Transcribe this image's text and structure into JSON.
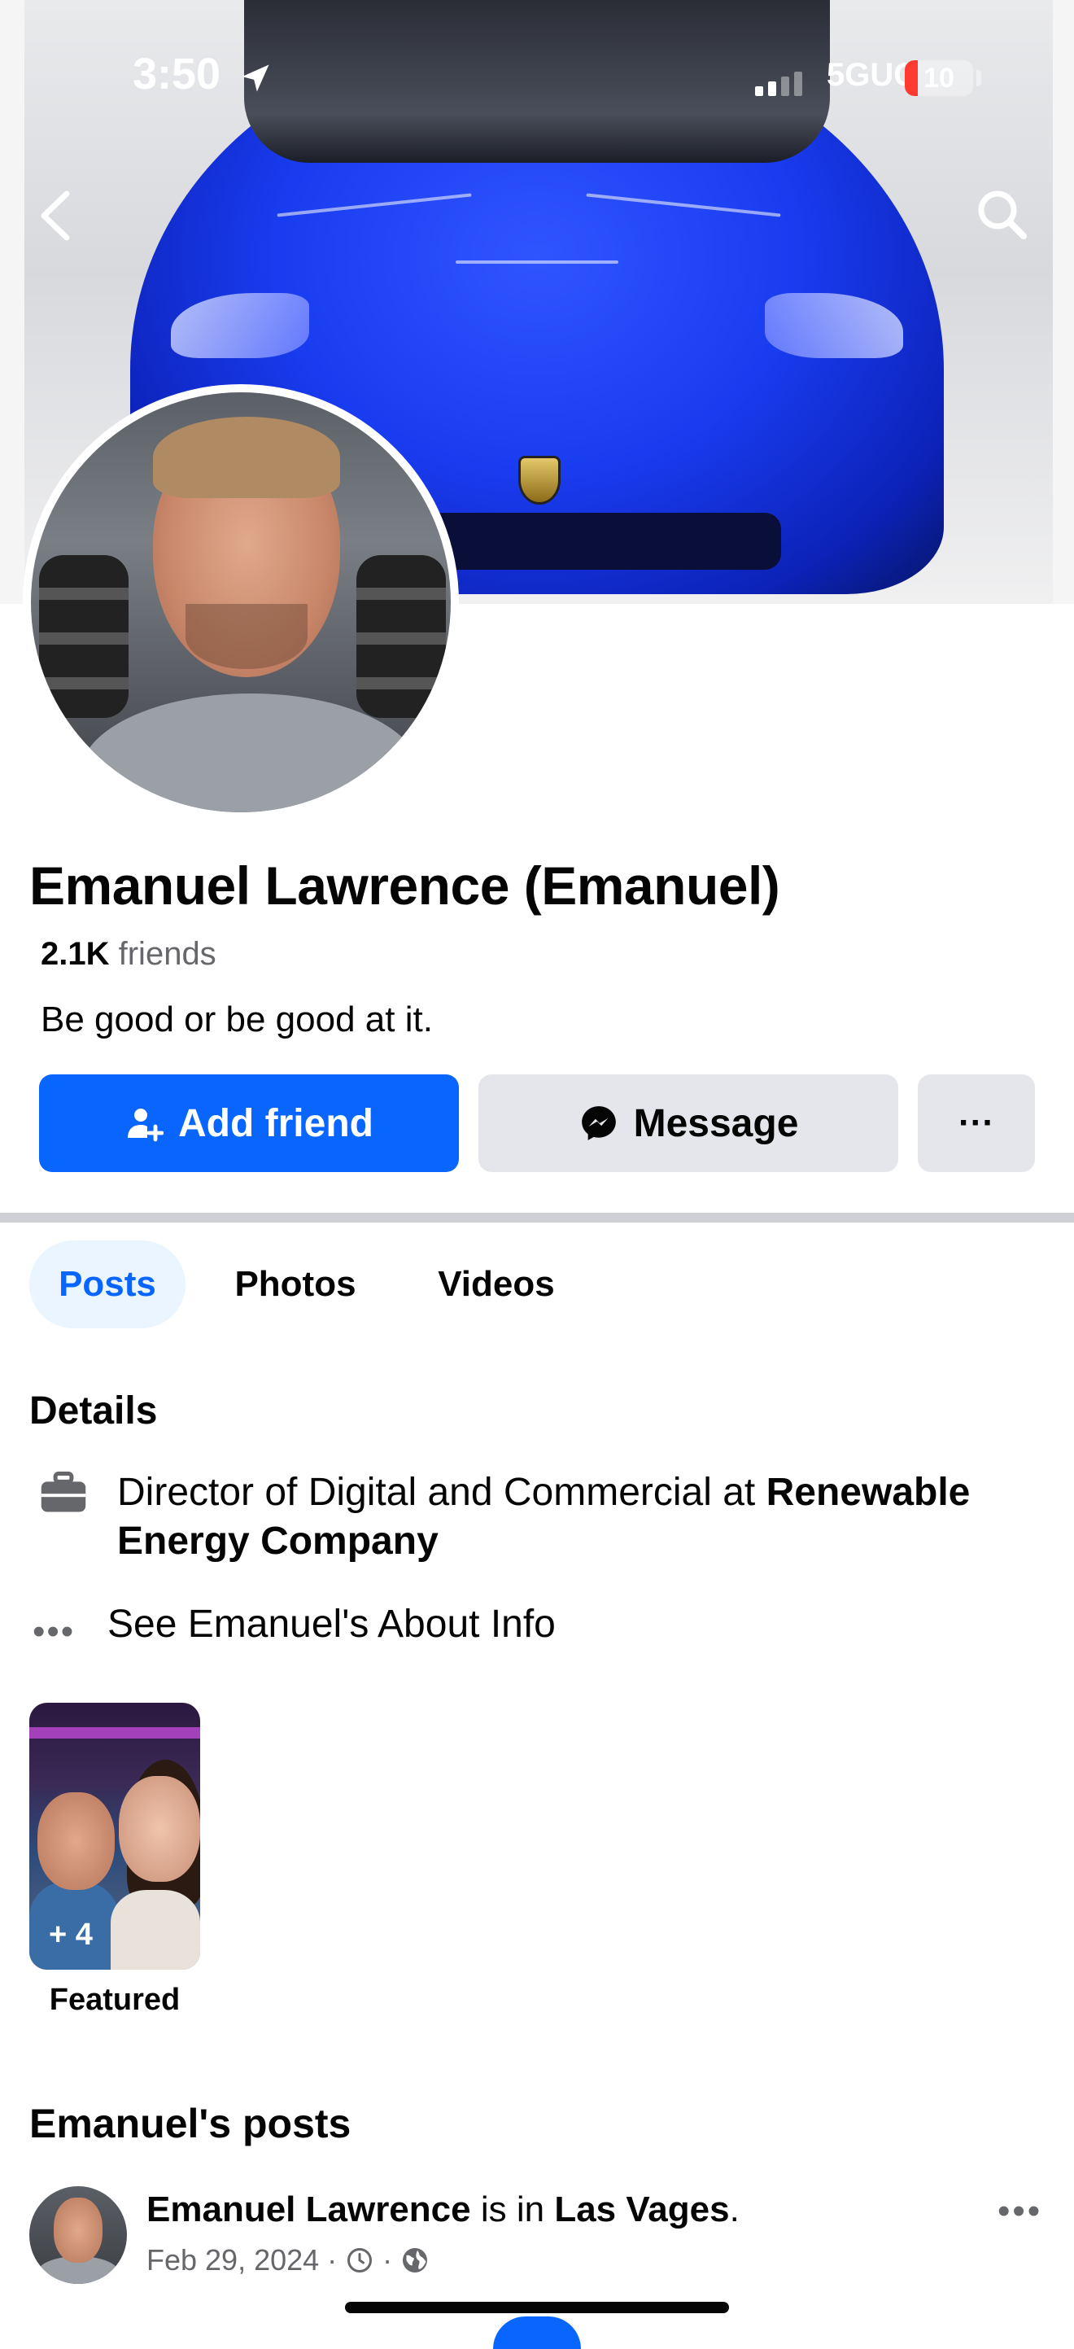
{
  "status_bar": {
    "time": "3:50",
    "network": "5GUC",
    "battery": "10"
  },
  "nav": {
    "back_icon": "chevron-left-icon",
    "search_icon": "search-icon"
  },
  "profile": {
    "name": "Emanuel Lawrence (Emanuel)",
    "friends_count": "2.1K",
    "friends_label": "friends",
    "bio": "Be good or be good at it."
  },
  "actions": {
    "add_friend": "Add friend",
    "message": "Message",
    "more": "···"
  },
  "tabs": [
    {
      "label": "Posts",
      "active": true
    },
    {
      "label": "Photos",
      "active": false
    },
    {
      "label": "Videos",
      "active": false
    }
  ],
  "details": {
    "title": "Details",
    "job_prefix": "Director of Digital and Commercial at ",
    "job_company": "Renewable Energy Company",
    "about_link": "See Emanuel's About Info"
  },
  "featured": {
    "count": "+ 4",
    "label": "Featured"
  },
  "posts_section": {
    "title": "Emanuel's posts",
    "post": {
      "author": "Emanuel Lawrence",
      "mid_text": " is in ",
      "place": "Las Vages",
      "end": ".",
      "date": "Feb 29, 2024",
      "sep": "·"
    }
  },
  "colors": {
    "accent": "#0866ff",
    "secondary_button": "#e4e6eb",
    "muted_text": "#65676b"
  }
}
